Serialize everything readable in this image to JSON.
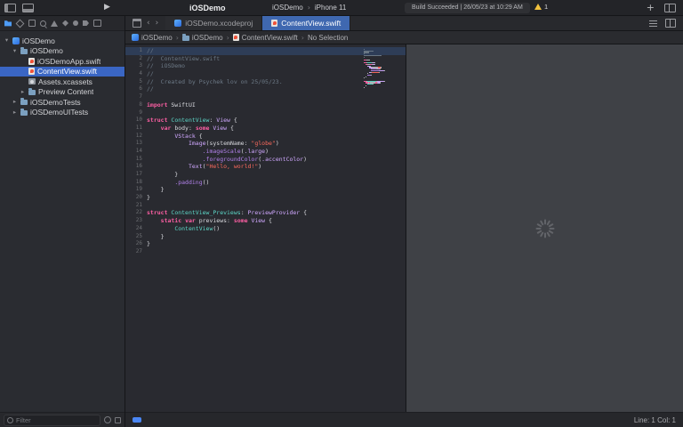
{
  "icons": {
    "play": "▶",
    "plus": "+",
    "chevron_sep": "›",
    "back_chevron": "‹",
    "forward_chevron": "›",
    "disclosure_open": "▾",
    "disclosure_closed": "▸"
  },
  "colors": {
    "accent": "#3a66c4",
    "active_tab": "#3f68b0",
    "warning": "#f2c23e",
    "tokens": {
      "cm": "#6c7986",
      "kw": "#fc5fa3",
      "ty": "#d0a8ff",
      "td": "#5dd8c8",
      "fn": "#b281eb",
      "mb": "#d0a8ff",
      "str": "#fc6a5d",
      "pl": "#b8b9bf"
    }
  },
  "toolbar": {
    "project_title": "iOSDemo",
    "scheme": "iOSDemo",
    "device": "iPhone 11",
    "status": "Build Succeeded | 26/05/23 at 10:29 AM",
    "warning_count": "1"
  },
  "tab_bar": {
    "tabs": [
      {
        "label": "iOSDemo.xcodeproj",
        "icon": "xcodeproj",
        "active": false
      },
      {
        "label": "ContentView.swift",
        "icon": "swift",
        "active": true
      }
    ]
  },
  "breadcrumb": {
    "items": [
      {
        "label": "iOSDemo",
        "icon": "app"
      },
      {
        "label": "iOSDemo",
        "icon": "folder"
      },
      {
        "label": "ContentView.swift",
        "icon": "swift"
      },
      {
        "label": "No Selection",
        "icon": "none"
      }
    ]
  },
  "sidebar": {
    "nav_icons": [
      "project-navigator",
      "source-control",
      "symbols",
      "search",
      "issues",
      "tests",
      "debug",
      "breakpoints",
      "reports"
    ],
    "items": [
      {
        "label": "iOSDemo",
        "icon": "app",
        "level": 0,
        "disclosure": "open",
        "selected": false
      },
      {
        "label": "iOSDemo",
        "icon": "folder",
        "level": 1,
        "disclosure": "open",
        "selected": false
      },
      {
        "label": "iOSDemoApp.swift",
        "icon": "swift",
        "level": 2,
        "disclosure": null,
        "selected": false
      },
      {
        "label": "ContentView.swift",
        "icon": "swift",
        "level": 2,
        "disclosure": null,
        "selected": true
      },
      {
        "label": "Assets.xcassets",
        "icon": "assets",
        "level": 2,
        "disclosure": null,
        "selected": false
      },
      {
        "label": "Preview Content",
        "icon": "folder",
        "level": 2,
        "disclosure": "closed",
        "selected": false
      },
      {
        "label": "iOSDemoTests",
        "icon": "folder",
        "level": 1,
        "disclosure": "closed",
        "selected": false
      },
      {
        "label": "iOSDemoUITests",
        "icon": "folder",
        "level": 1,
        "disclosure": "closed",
        "selected": false
      }
    ],
    "filter_placeholder": "Filter"
  },
  "editor": {
    "current_line": 1,
    "lines": [
      [
        [
          "cm",
          "//"
        ]
      ],
      [
        [
          "cm",
          "//  ContentView.swift"
        ]
      ],
      [
        [
          "cm",
          "//  iOSDemo"
        ]
      ],
      [
        [
          "cm",
          "//"
        ]
      ],
      [
        [
          "cm",
          "//  Created by Psychek lov on 25/05/23."
        ]
      ],
      [
        [
          "cm",
          "//"
        ]
      ],
      [],
      [
        [
          "kw",
          "import"
        ],
        [
          "pl",
          " SwiftUI"
        ]
      ],
      [],
      [
        [
          "kw",
          "struct"
        ],
        [
          "pl",
          " "
        ],
        [
          "td",
          "ContentView"
        ],
        [
          "pl",
          ": "
        ],
        [
          "ty",
          "View"
        ],
        [
          "pl",
          " {"
        ]
      ],
      [
        [
          "pl",
          "    "
        ],
        [
          "kw",
          "var"
        ],
        [
          "pl",
          " body: "
        ],
        [
          "kw",
          "some"
        ],
        [
          "pl",
          " "
        ],
        [
          "ty",
          "View"
        ],
        [
          "pl",
          " {"
        ]
      ],
      [
        [
          "pl",
          "        "
        ],
        [
          "ty",
          "VStack"
        ],
        [
          "pl",
          " {"
        ]
      ],
      [
        [
          "pl",
          "            "
        ],
        [
          "ty",
          "Image"
        ],
        [
          "pl",
          "(systemName: "
        ],
        [
          "str",
          "\"globe\""
        ],
        [
          "pl",
          ")"
        ]
      ],
      [
        [
          "pl",
          "                "
        ],
        [
          "fn",
          ".imageScale"
        ],
        [
          "pl",
          "("
        ],
        [
          "mb",
          ".large"
        ],
        [
          "pl",
          ")"
        ]
      ],
      [
        [
          "pl",
          "                "
        ],
        [
          "fn",
          ".foregroundColor"
        ],
        [
          "pl",
          "("
        ],
        [
          "mb",
          ".accentColor"
        ],
        [
          "pl",
          ")"
        ]
      ],
      [
        [
          "pl",
          "            "
        ],
        [
          "ty",
          "Text"
        ],
        [
          "pl",
          "("
        ],
        [
          "str",
          "\"Hello, world!\""
        ],
        [
          "pl",
          ")"
        ]
      ],
      [
        [
          "pl",
          "        }"
        ]
      ],
      [
        [
          "pl",
          "        "
        ],
        [
          "fn",
          ".padding"
        ],
        [
          "pl",
          "()"
        ]
      ],
      [
        [
          "pl",
          "    }"
        ]
      ],
      [
        [
          "pl",
          "}"
        ]
      ],
      [],
      [
        [
          "kw",
          "struct"
        ],
        [
          "pl",
          " "
        ],
        [
          "td",
          "ContentView_Previews"
        ],
        [
          "pl",
          ": "
        ],
        [
          "ty",
          "PreviewProvider"
        ],
        [
          "pl",
          " {"
        ]
      ],
      [
        [
          "pl",
          "    "
        ],
        [
          "kw",
          "static"
        ],
        [
          "pl",
          " "
        ],
        [
          "kw",
          "var"
        ],
        [
          "pl",
          " previews: "
        ],
        [
          "kw",
          "some"
        ],
        [
          "pl",
          " "
        ],
        [
          "ty",
          "View"
        ],
        [
          "pl",
          " {"
        ]
      ],
      [
        [
          "pl",
          "        "
        ],
        [
          "td",
          "ContentView"
        ],
        [
          "pl",
          "()"
        ]
      ],
      [
        [
          "pl",
          "    }"
        ]
      ],
      [
        [
          "pl",
          "}"
        ]
      ],
      []
    ]
  },
  "status_bar": {
    "cursor": "Line: 1 Col: 1"
  }
}
